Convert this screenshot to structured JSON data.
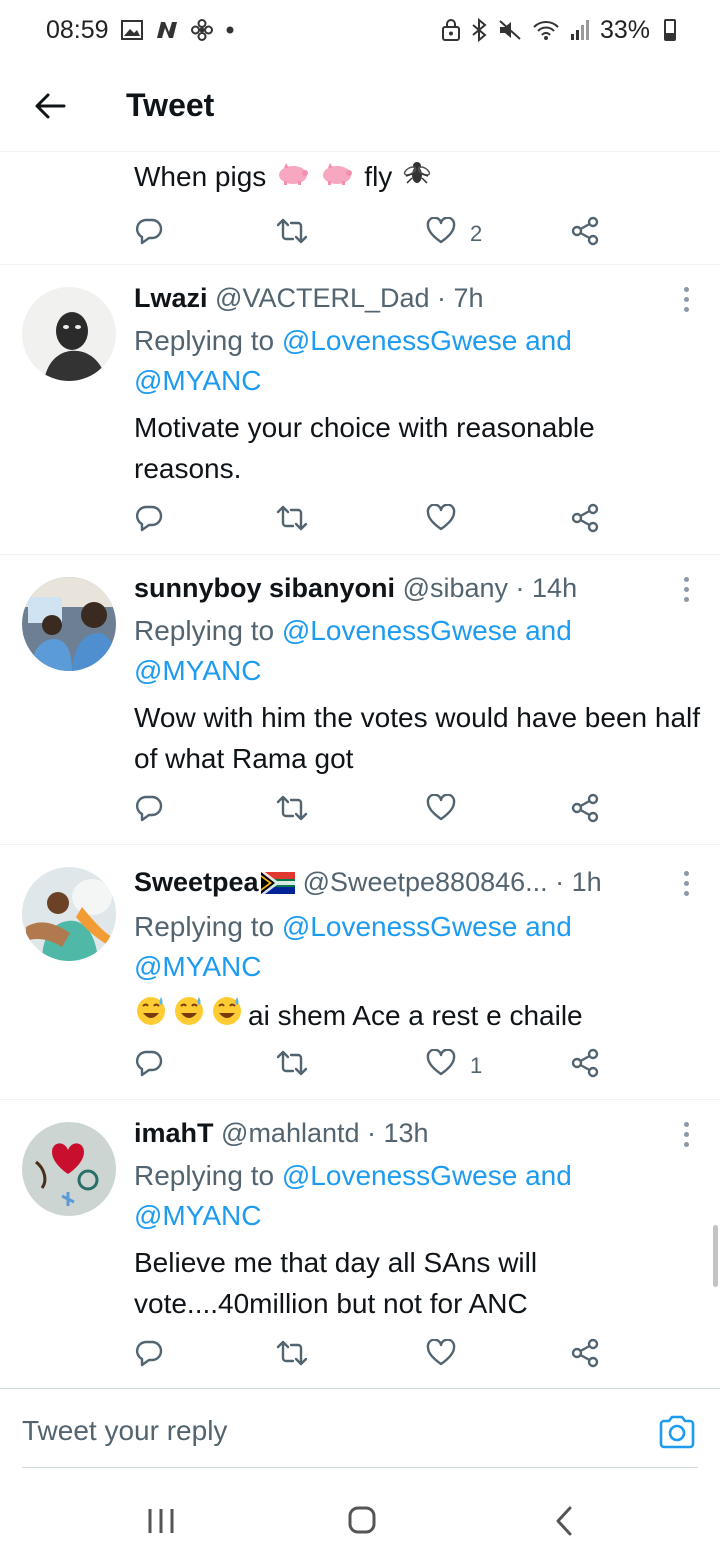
{
  "status_bar": {
    "time": "08:59",
    "battery": "33%",
    "icons": [
      "gallery-icon",
      "n-icon",
      "fan-icon",
      "dot-icon",
      "lock-icon",
      "bluetooth-icon",
      "mute-icon",
      "wifi-icon",
      "signal-icon",
      "battery-icon"
    ]
  },
  "header": {
    "title": "Tweet"
  },
  "partial_tweet": {
    "text_before": "When pigs",
    "text_after": "fly",
    "likes": "2"
  },
  "tweets": [
    {
      "name": "Lwazi",
      "handle": "@VACTERL_Dad",
      "time": "· 7h",
      "replying_prefix": "Replying to",
      "replying_to": "@LovenessGwese and @MYANC",
      "text": "Motivate your choice with reasonable reasons.",
      "likes": ""
    },
    {
      "name": "sunnyboy sibanyoni",
      "handle": "@sibany",
      "time": "· 14h",
      "replying_prefix": "Replying to",
      "replying_to": "@LovenessGwese and @MYANC",
      "text": "Wow with him the votes would have been half of what Rama got",
      "likes": ""
    },
    {
      "name": "Sweetpea",
      "handle": "@Sweetpe880846...",
      "time": "· 1h",
      "replying_prefix": "Replying to",
      "replying_to": "@LovenessGwese and @MYANC",
      "text": "ai shem Ace a rest e chaile",
      "likes": "1"
    },
    {
      "name": "imahT",
      "handle": "@mahlantd",
      "time": "· 13h",
      "replying_prefix": "Replying to",
      "replying_to": "@LovenessGwese and @MYANC",
      "text": "Believe me that day all SAns will vote....40million but not for ANC",
      "likes": ""
    }
  ],
  "compose": {
    "placeholder": "Tweet your reply"
  },
  "colors": {
    "accent": "#1d9bf0",
    "secondary_text": "#536471",
    "divider": "#eff3f4"
  }
}
